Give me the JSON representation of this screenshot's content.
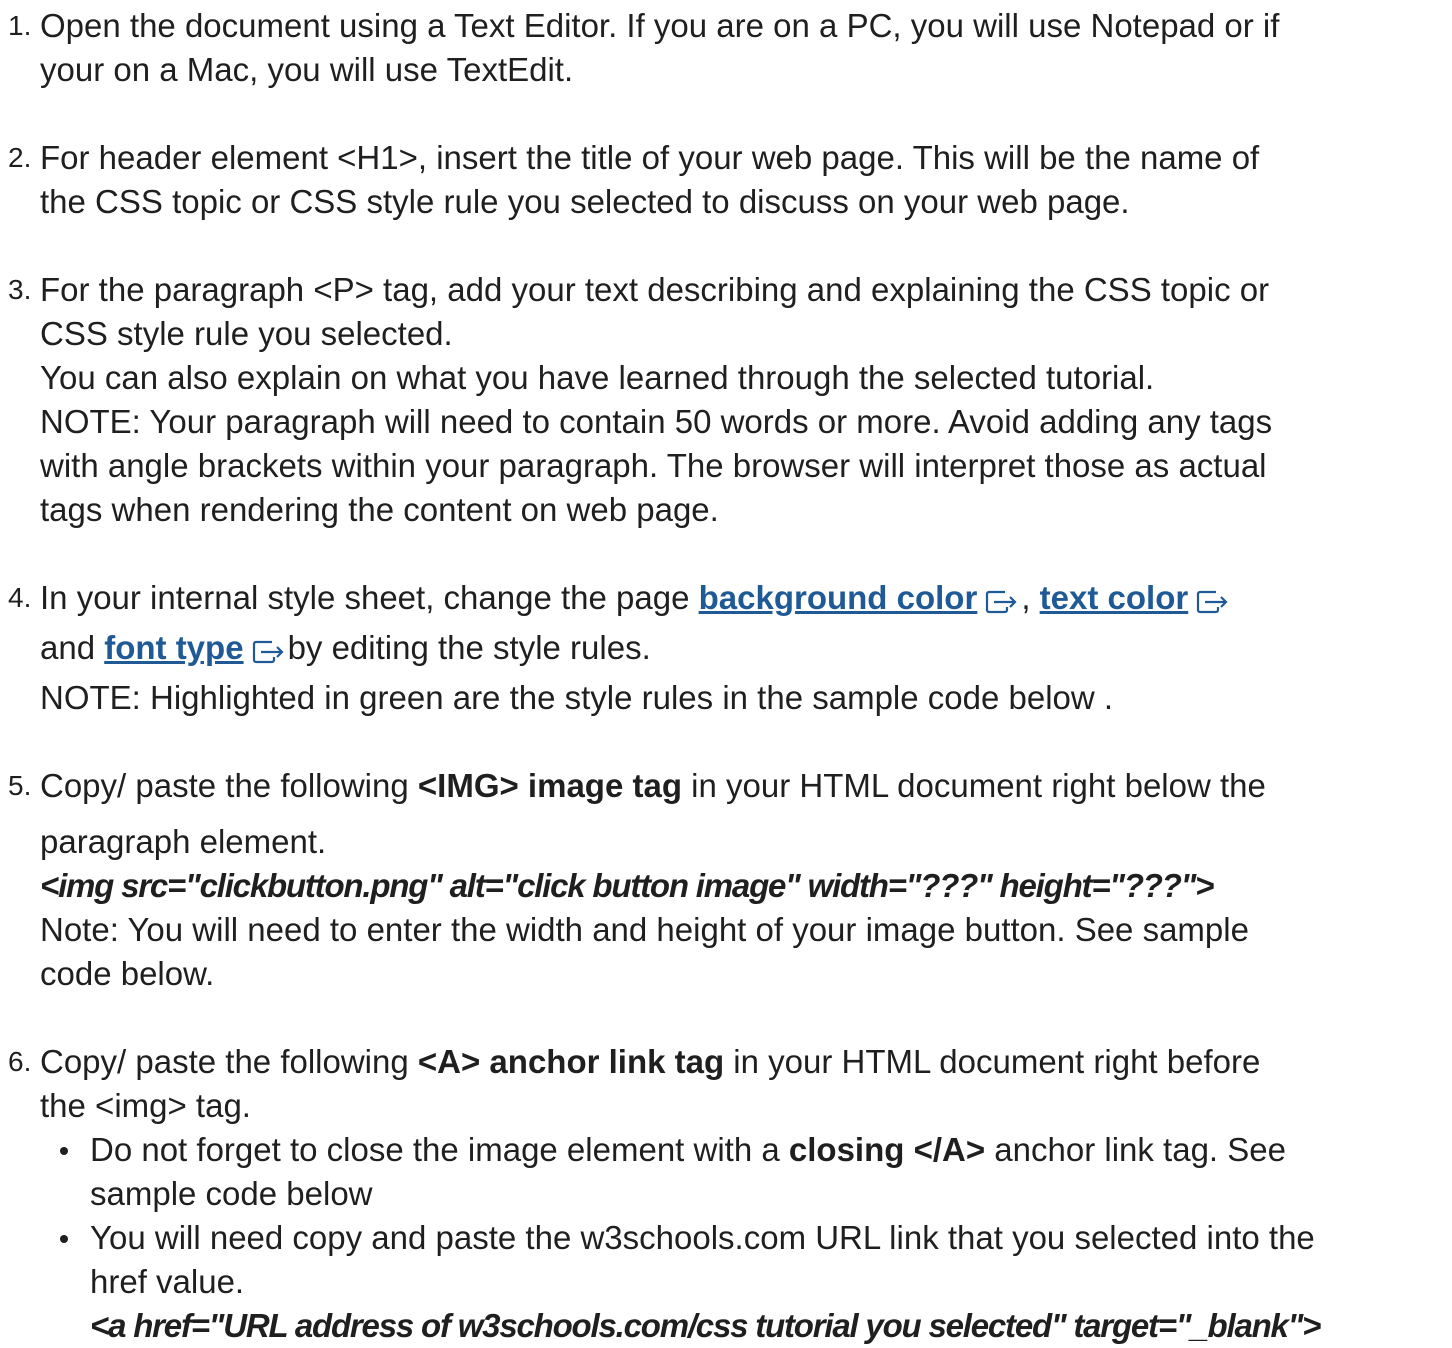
{
  "steps": [
    {
      "num": "1.",
      "lines": [
        "Open the document using a Text Editor.  If you are on a PC, you will use Notepad or if",
        "your on a Mac, you will use TextEdit."
      ]
    },
    {
      "num": "2.",
      "lines": [
        "For header element <H1>, insert the title of your web page.   This will be the name of",
        "the CSS topic or CSS style rule you selected to discuss on your web page."
      ]
    },
    {
      "num": "3.",
      "lines": [
        "For the paragraph <P> tag, add your text describing and explaining the CSS topic or",
        "CSS style rule you selected.",
        "You can also explain on what you have learned through the selected tutorial.",
        "NOTE:  Your paragraph will need to contain 50 words or more.   Avoid adding any tags",
        "with angle brackets within your paragraph.  The browser will interpret those as actual",
        "tags when rendering the content on web page."
      ]
    },
    {
      "num": "4.",
      "text_a": "In your internal style sheet, change the page ",
      "link_background": "background color",
      "comma": ",",
      "link_text_color": "text color",
      "text_and": "and ",
      "link_font": "font type",
      "text_b": "by editing the style rules.",
      "note": "NOTE: Highlighted in green  are the style rules in the sample code below ."
    },
    {
      "num": "5.",
      "text_a": "Copy/ paste the following ",
      "bold": "<IMG> image tag",
      "text_b": " in your HTML document right below the",
      "text_c": "paragraph element.",
      "code": "<img src=\"clickbutton.png\" alt=\"click button image\" width=\"???\" height=\"???\">",
      "note_1": " Note: You will need to enter the width and height of your image button.    See sample",
      "note_2": "code below."
    },
    {
      "num": "6.",
      "text_a": "Copy/ paste the following ",
      "bold": "<A> anchor link tag",
      "text_b": " in your HTML document right before",
      "text_c": "the <img> tag.",
      "bullets": {
        "b1_a": "Do not forget to close the image element with a ",
        "b1_bold": "closing </A>",
        "b1_b": " anchor link tag.   See",
        "b1_c": "sample code below",
        "b2_a": "You will need copy and paste the w3schools.com URL link that you selected into the",
        "b2_b": "href value.",
        "b2_code": "<a href=\"URL address of w3schools.com/css tutorial you selected\" target=\"_blank\">"
      }
    }
  ]
}
